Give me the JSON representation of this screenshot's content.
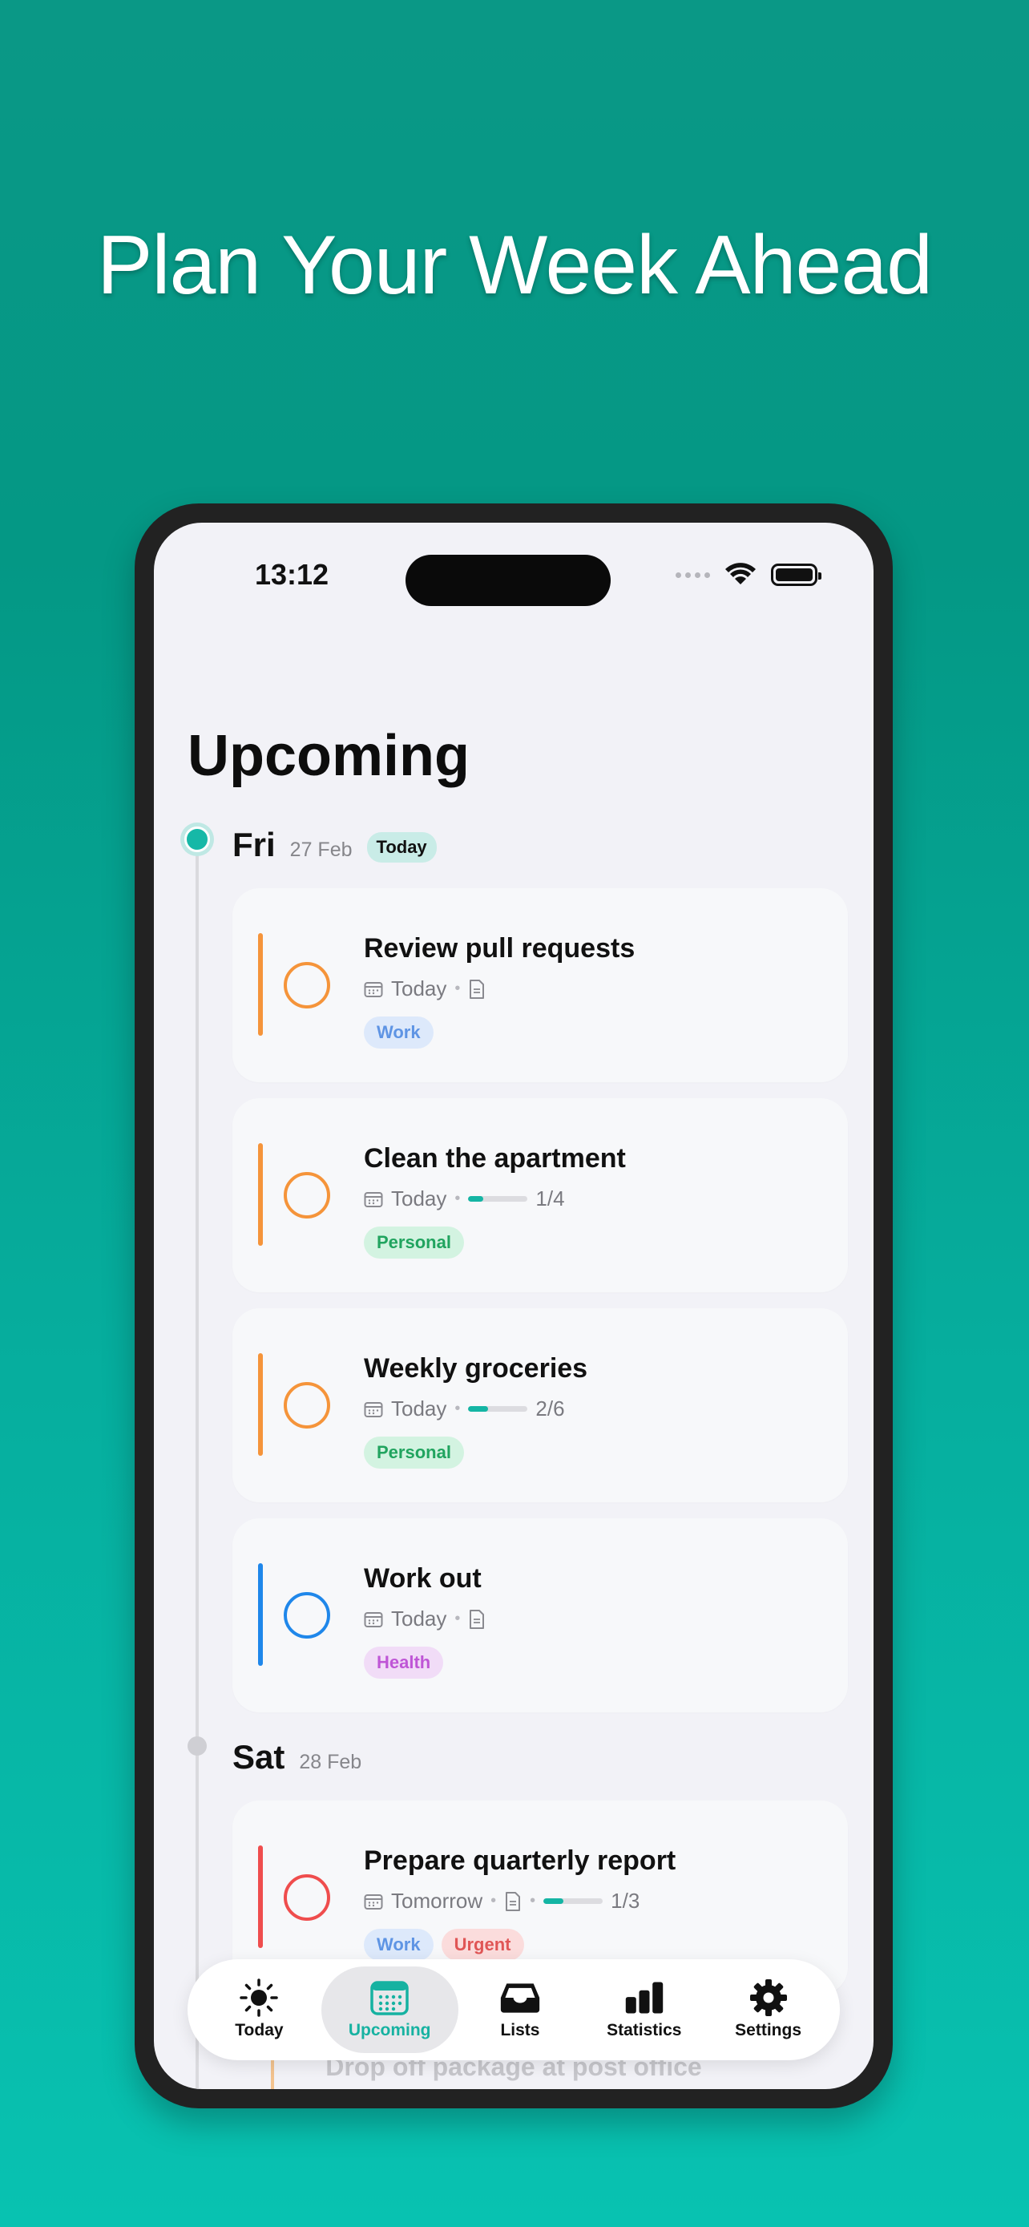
{
  "headline": "Plan Your Week Ahead",
  "status_bar": {
    "time": "13:12"
  },
  "page": {
    "title": "Upcoming"
  },
  "days": [
    {
      "name": "Fri",
      "date": "27 Feb",
      "badge": "Today"
    },
    {
      "name": "Sat",
      "date": "28 Feb"
    }
  ],
  "tasks": [
    {
      "title": "Review pull requests",
      "due": "Today",
      "has_note": true,
      "tags": [
        "Work"
      ],
      "priority_color": "#f5943a",
      "progress": null
    },
    {
      "title": "Clean the apartment",
      "due": "Today",
      "has_note": false,
      "progress_label": "1/4",
      "progress": 0.25,
      "tags": [
        "Personal"
      ],
      "priority_color": "#f5943a"
    },
    {
      "title": "Weekly groceries",
      "due": "Today",
      "has_note": false,
      "progress_label": "2/6",
      "progress": 0.33,
      "tags": [
        "Personal"
      ],
      "priority_color": "#f5943a"
    },
    {
      "title": "Work out",
      "due": "Today",
      "has_note": true,
      "tags": [
        "Health"
      ],
      "priority_color": "#1f87ea",
      "progress": null
    },
    {
      "title": "Prepare quarterly report",
      "due": "Tomorrow",
      "has_note": true,
      "progress_label": "1/3",
      "progress": 0.33,
      "tags": [
        "Work",
        "Urgent"
      ],
      "priority_color": "#ef4d4d"
    }
  ],
  "faded_task": "Drop off package at post office",
  "tab_bar": {
    "items": [
      {
        "label": "Today",
        "icon": "sun-icon"
      },
      {
        "label": "Upcoming",
        "icon": "calendar-icon",
        "active": true
      },
      {
        "label": "Lists",
        "icon": "tray-icon"
      },
      {
        "label": "Statistics",
        "icon": "bar-chart-icon"
      },
      {
        "label": "Settings",
        "icon": "gear-icon"
      }
    ]
  },
  "colors": {
    "accent": "#16b8a7",
    "background_top": "#049885",
    "background_bottom": "#08c2b1"
  }
}
